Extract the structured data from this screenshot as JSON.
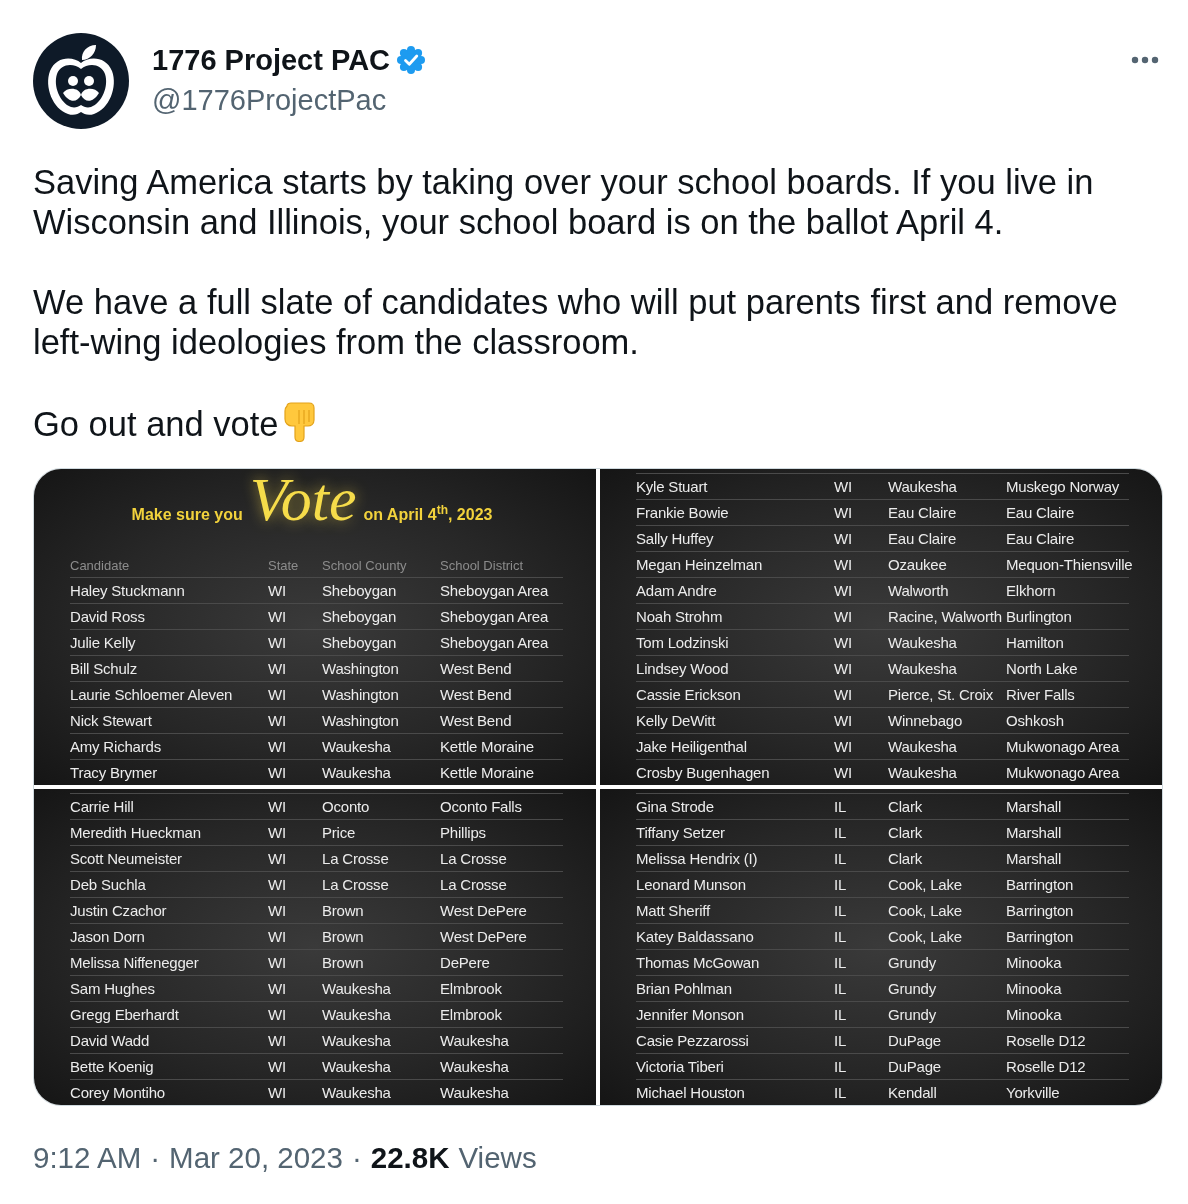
{
  "author": {
    "name": "1776 Project PAC",
    "verified": true,
    "handle": "@1776ProjectPac"
  },
  "paragraphs": [
    {
      "text": "Saving America starts by taking over your school boards. If you live in Wisconsin and Illinois, your school board is on the ballot April 4.",
      "emoji": false
    },
    {
      "text": "We have a full slate of candidates who will put parents first and remove left-wing ideologies from the classroom.",
      "emoji": false
    },
    {
      "text": "Go out and vote",
      "emoji": true
    }
  ],
  "media": {
    "panels": [
      {
        "banner": {
          "before": "Make sure you",
          "script": "Vote",
          "after": "on April 4$^{th}$, 2023"
        },
        "columns": [
          "Candidate",
          "State",
          "School County",
          "School District"
        ],
        "rows": [
          [
            "Haley Stuckmann",
            "WI",
            "Sheboygan",
            "Sheboygan Area"
          ],
          [
            "David Ross",
            "WI",
            "Sheboygan",
            "Sheboygan Area"
          ],
          [
            "Julie Kelly",
            "WI",
            "Sheboygan",
            "Sheboygan Area"
          ],
          [
            "Bill Schulz",
            "WI",
            "Washington",
            "West Bend"
          ],
          [
            "Laurie Schloemer Aleven",
            "WI",
            "Washington",
            "West Bend"
          ],
          [
            "Nick Stewart",
            "WI",
            "Washington",
            "West Bend"
          ],
          [
            "Amy Richards",
            "WI",
            "Waukesha",
            "Kettle Moraine"
          ],
          [
            "Tracy Brymer",
            "WI",
            "Waukesha",
            "Kettle Moraine"
          ]
        ]
      },
      {
        "rows": [
          [
            "Kyle Stuart",
            "WI",
            "Waukesha",
            "Muskego Norway"
          ],
          [
            "Frankie Bowie",
            "WI",
            "Eau Claire",
            "Eau Claire"
          ],
          [
            "Sally Huffey",
            "WI",
            "Eau Claire",
            "Eau Claire"
          ],
          [
            "Megan Heinzelman",
            "WI",
            "Ozaukee",
            "Mequon-Thiensville"
          ],
          [
            "Adam Andre",
            "WI",
            "Walworth",
            "Elkhorn"
          ],
          [
            "Noah Strohm",
            "WI",
            "Racine, Walworth",
            "Burlington"
          ],
          [
            "Tom Lodzinski",
            "WI",
            "Waukesha",
            "Hamilton"
          ],
          [
            "Lindsey Wood",
            "WI",
            "Waukesha",
            "North Lake"
          ],
          [
            "Cassie Erickson",
            "WI",
            "Pierce, St. Croix",
            "River Falls"
          ],
          [
            "Kelly DeWitt",
            "WI",
            "Winnebago",
            "Oshkosh"
          ],
          [
            "Jake Heiligenthal",
            "WI",
            "Waukesha",
            "Mukwonago Area"
          ],
          [
            "Crosby Bugenhagen",
            "WI",
            "Waukesha",
            "Mukwonago Area"
          ]
        ]
      },
      {
        "rows": [
          [
            "Carrie Hill",
            "WI",
            "Oconto",
            "Oconto Falls"
          ],
          [
            "Meredith Hueckman",
            "WI",
            "Price",
            "Phillips"
          ],
          [
            "Scott Neumeister",
            "WI",
            "La Crosse",
            "La Crosse"
          ],
          [
            "Deb Suchla",
            "WI",
            "La Crosse",
            "La Crosse"
          ],
          [
            "Justin Czachor",
            "WI",
            "Brown",
            "West DePere"
          ],
          [
            "Jason Dorn",
            "WI",
            "Brown",
            "West DePere"
          ],
          [
            "Melissa Niffenegger",
            "WI",
            "Brown",
            "DePere"
          ],
          [
            "Sam Hughes",
            "WI",
            "Waukesha",
            "Elmbrook"
          ],
          [
            "Gregg Eberhardt",
            "WI",
            "Waukesha",
            "Elmbrook"
          ],
          [
            "David Wadd",
            "WI",
            "Waukesha",
            "Waukesha"
          ],
          [
            "Bette Koenig",
            "WI",
            "Waukesha",
            "Waukesha"
          ],
          [
            "Corey Montiho",
            "WI",
            "Waukesha",
            "Waukesha"
          ]
        ]
      },
      {
        "rows": [
          [
            "Gina Strode",
            "IL",
            "Clark",
            "Marshall"
          ],
          [
            "Tiffany Setzer",
            "IL",
            "Clark",
            "Marshall"
          ],
          [
            "Melissa Hendrix (I)",
            "IL",
            "Clark",
            "Marshall"
          ],
          [
            "Leonard Munson",
            "IL",
            "Cook, Lake",
            "Barrington"
          ],
          [
            "Matt Sheriff",
            "IL",
            "Cook, Lake",
            "Barrington"
          ],
          [
            "Katey Baldassano",
            "IL",
            "Cook, Lake",
            "Barrington"
          ],
          [
            "Thomas McGowan",
            "IL",
            "Grundy",
            "Minooka"
          ],
          [
            "Brian Pohlman",
            "IL",
            "Grundy",
            "Minooka"
          ],
          [
            "Jennifer Monson",
            "IL",
            "Grundy",
            "Minooka"
          ],
          [
            "Casie Pezzarossi",
            "IL",
            "DuPage",
            "Roselle D12"
          ],
          [
            "Victoria Tiberi",
            "IL",
            "DuPage",
            "Roselle D12"
          ],
          [
            "Michael Houston",
            "IL",
            "Kendall",
            "Yorkville"
          ]
        ]
      }
    ]
  },
  "meta": [
    {
      "kind": "time",
      "text": "9:12 AM"
    },
    {
      "kind": "separator",
      "text": "·"
    },
    {
      "kind": "date",
      "text": "Mar 20, 2023"
    },
    {
      "kind": "separator",
      "text": "·"
    },
    {
      "kind": "count",
      "text": "22.8K"
    },
    {
      "kind": "label",
      "text": "Views"
    }
  ]
}
